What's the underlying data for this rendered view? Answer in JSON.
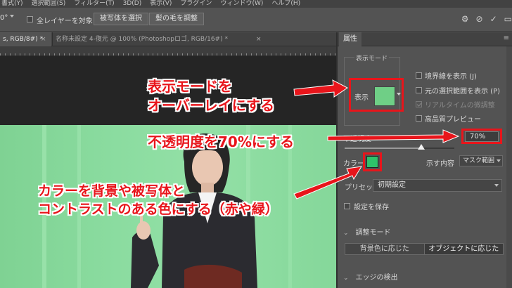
{
  "menubar": {
    "items": [
      "書式(Y)",
      "選択範囲(S)",
      "フィルター(T)",
      "3D(D)",
      "表示(V)",
      "プラグイン",
      "ウィンドウ(W)",
      "ヘルプ(H)"
    ]
  },
  "options": {
    "angle_value": "0°",
    "all_layers_label": "全レイヤーを対象",
    "select_subject_label": "被写体を選択",
    "refine_hair_label": "髪の毛を調整"
  },
  "tabs": [
    {
      "label": "s, RGB/8#) *",
      "active": true
    },
    {
      "label": "名称未設定 4-復元 @ 100% (Photoshopロゴ, RGB/16#) *",
      "active": false
    }
  ],
  "panel": {
    "tab_label": "属性",
    "view_mode_title": "表示モード",
    "view_label": "表示",
    "checkboxes": [
      {
        "label": "境界線を表示 (J)",
        "disabled": false
      },
      {
        "label": "元の選択範囲を表示 (P)",
        "disabled": false
      },
      {
        "label": "リアルタイムの微調整",
        "disabled": true
      },
      {
        "label": "高品質プレビュー",
        "disabled": false
      }
    ],
    "opacity_label": "不透明度",
    "opacity_value": "70%",
    "opacity_level": 0.7,
    "color_label": "カラー",
    "color_hex": "#2ec36a",
    "show_label": "示す内容",
    "show_value": "マスク範囲",
    "preset_label": "プリセット",
    "preset_value": "初期設定",
    "save_settings_label": "設定を保存",
    "adjust_mode_label": "調整モード",
    "mode_buttons": [
      "背景色に応じた",
      "オブジェクトに応じた"
    ],
    "edge_detect_label": "エッジの検出"
  },
  "annotations": {
    "mode_line1": "表示モードを",
    "mode_line2": "オーバーレイにする",
    "opacity": "不透明度を70%にする",
    "color_line1": "カラーを背景や被写体と",
    "color_line2": "コントラストのある色にする（赤や緑）",
    "highlight_color": "#e8151b"
  }
}
